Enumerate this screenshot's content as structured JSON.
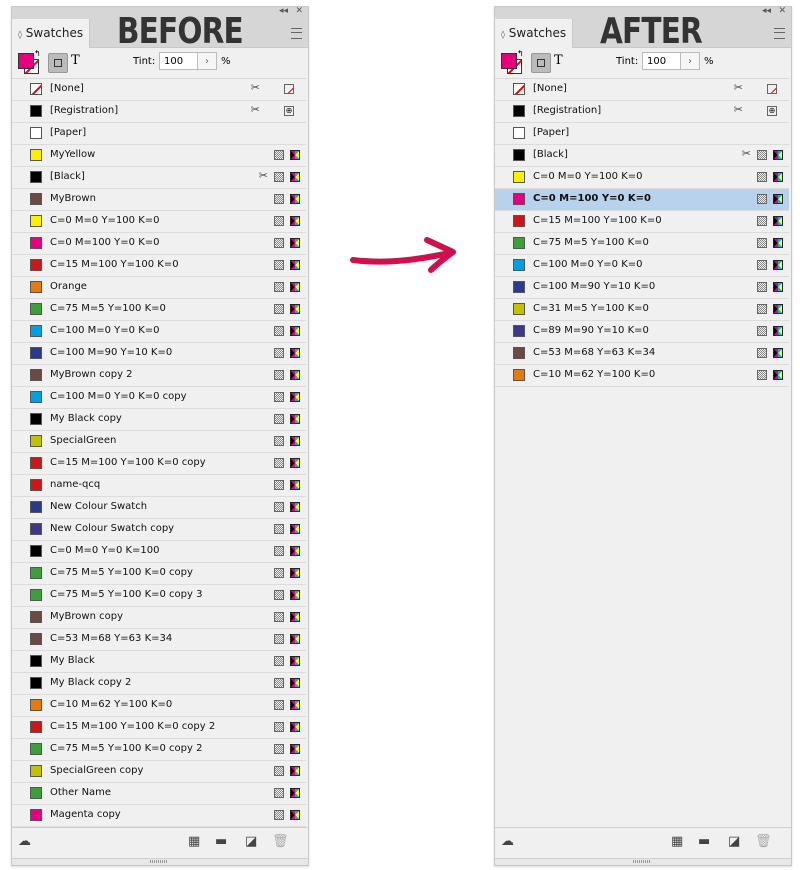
{
  "before": {
    "heading": "BEFORE",
    "tab": "Swatches",
    "tint_label": "Tint:",
    "tint_value": "100",
    "pct": "%",
    "items": [
      {
        "name": "[None]",
        "color": "none",
        "pen": true,
        "type": "none"
      },
      {
        "name": "[Registration]",
        "color": "#000000",
        "pen": true,
        "type": "reg"
      },
      {
        "name": "[Paper]",
        "color": "#ffffff",
        "type": ""
      },
      {
        "name": "MyYellow",
        "color": "#ffed00",
        "type": "cmyk"
      },
      {
        "name": "[Black]",
        "color": "#000000",
        "pen": true,
        "type": "cmyk"
      },
      {
        "name": "MyBrown",
        "color": "#6b4a44",
        "type": "cmyk"
      },
      {
        "name": "C=0 M=0 Y=100 K=0",
        "color": "#fff000",
        "type": "cmyk"
      },
      {
        "name": "C=0 M=100 Y=0 K=0",
        "color": "#e6007e",
        "type": "cmyk"
      },
      {
        "name": "C=15 M=100 Y=100 K=0",
        "color": "#cc1719",
        "type": "cmyk"
      },
      {
        "name": "Orange",
        "color": "#e57a10",
        "type": "cmyk"
      },
      {
        "name": "C=75 M=5 Y=100 K=0",
        "color": "#3aa037",
        "type": "cmyk"
      },
      {
        "name": "C=100 M=0 Y=0 K=0",
        "color": "#009fe3",
        "type": "cmyk"
      },
      {
        "name": "C=100 M=90 Y=10 K=0",
        "color": "#2b3990",
        "type": "cmyk"
      },
      {
        "name": "MyBrown copy 2",
        "color": "#6b4a44",
        "type": "cmyk"
      },
      {
        "name": "C=100 M=0 Y=0 K=0 copy",
        "color": "#009fe3",
        "type": "cmyk"
      },
      {
        "name": "My Black copy",
        "color": "#000000",
        "type": "cmyk"
      },
      {
        "name": "SpecialGreen",
        "color": "#c2c200",
        "type": "cmyk"
      },
      {
        "name": "C=15 M=100 Y=100 K=0 copy",
        "color": "#cc1719",
        "type": "cmyk"
      },
      {
        "name": "name-qcq",
        "color": "#cc1719",
        "type": "cmyk"
      },
      {
        "name": "New Colour Swatch",
        "color": "#283a8e",
        "type": "cmyk"
      },
      {
        "name": "New Colour Swatch copy",
        "color": "#41378a",
        "type": "cmyk"
      },
      {
        "name": "C=0 M=0 Y=0 K=100",
        "color": "#000000",
        "type": "cmyk"
      },
      {
        "name": "C=75 M=5 Y=100 K=0 copy",
        "color": "#3aa037",
        "type": "cmyk"
      },
      {
        "name": "C=75 M=5 Y=100 K=0 copy 3",
        "color": "#3aa037",
        "type": "cmyk"
      },
      {
        "name": "MyBrown copy",
        "color": "#6b4a44",
        "type": "cmyk"
      },
      {
        "name": "C=53 M=68 Y=63 K=34",
        "color": "#6b4a44",
        "type": "cmyk"
      },
      {
        "name": "My Black",
        "color": "#000000",
        "type": "cmyk"
      },
      {
        "name": "My Black copy 2",
        "color": "#000000",
        "type": "cmyk"
      },
      {
        "name": "C=10 M=62 Y=100 K=0",
        "color": "#e57a10",
        "type": "cmyk"
      },
      {
        "name": "C=15 M=100 Y=100 K=0 copy 2",
        "color": "#cc1719",
        "type": "cmyk"
      },
      {
        "name": "C=75 M=5 Y=100 K=0 copy 2",
        "color": "#3aa037",
        "type": "cmyk"
      },
      {
        "name": "SpecialGreen copy",
        "color": "#c2c200",
        "type": "cmyk"
      },
      {
        "name": "Other Name",
        "color": "#3aa037",
        "type": "cmyk"
      },
      {
        "name": "Magenta copy",
        "color": "#e6007e",
        "type": "cmyk"
      }
    ]
  },
  "after": {
    "heading": "AFTER",
    "tab": "Swatches",
    "tint_label": "Tint:",
    "tint_value": "100",
    "pct": "%",
    "items": [
      {
        "name": "[None]",
        "color": "none",
        "pen": true,
        "type": "none"
      },
      {
        "name": "[Registration]",
        "color": "#000000",
        "pen": true,
        "type": "reg"
      },
      {
        "name": "[Paper]",
        "color": "#ffffff",
        "type": ""
      },
      {
        "name": "[Black]",
        "color": "#000000",
        "pen": true,
        "type": "cmyk"
      },
      {
        "name": "C=0 M=0 Y=100 K=0",
        "color": "#fff000",
        "type": "cmyk"
      },
      {
        "name": "C=0 M=100 Y=0 K=0",
        "color": "#e6007e",
        "type": "cmyk",
        "selected": true
      },
      {
        "name": "C=15 M=100 Y=100 K=0",
        "color": "#cc1719",
        "type": "cmyk"
      },
      {
        "name": "C=75 M=5 Y=100 K=0",
        "color": "#3aa037",
        "type": "cmyk"
      },
      {
        "name": "C=100 M=0 Y=0 K=0",
        "color": "#009fe3",
        "type": "cmyk"
      },
      {
        "name": "C=100 M=90 Y=10 K=0",
        "color": "#2b3990",
        "type": "cmyk"
      },
      {
        "name": "C=31 M=5 Y=100 K=0",
        "color": "#c2c200",
        "type": "cmyk"
      },
      {
        "name": "C=89 M=90 Y=10 K=0",
        "color": "#41378a",
        "type": "cmyk"
      },
      {
        "name": "C=53 M=68 Y=63 K=34",
        "color": "#6b4a44",
        "type": "cmyk"
      },
      {
        "name": "C=10 M=62 Y=100 K=0",
        "color": "#e57a10",
        "type": "cmyk"
      }
    ]
  },
  "arrow_color": "#d0104c"
}
